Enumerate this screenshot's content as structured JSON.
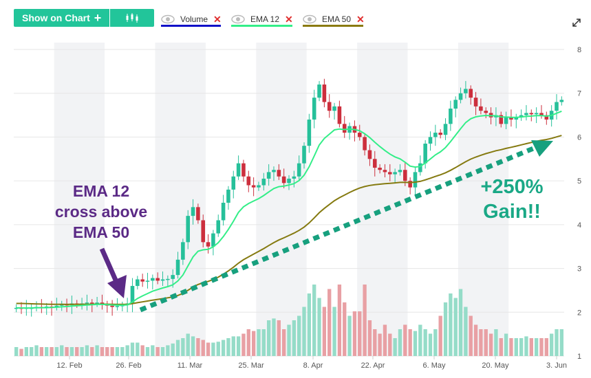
{
  "toolbar": {
    "show_on_chart_label": "Show on Chart",
    "plus_symbol": "+",
    "chart_type_icon": "candlestick-icon"
  },
  "legend": [
    {
      "label": "Volume",
      "color": "#1010c8"
    },
    {
      "label": "EMA 12",
      "color": "#33ee88"
    },
    {
      "label": "EMA 50",
      "color": "#8a7a10"
    }
  ],
  "remove_symbol": "✕",
  "expand_icon": "expand-icon",
  "annotations": {
    "cross_lines": [
      "EMA 12",
      "cross above",
      "EMA 50"
    ],
    "gain_lines": [
      "+250%",
      "Gain!!"
    ]
  },
  "colors": {
    "up": "#26c09a",
    "down": "#cc2f3d",
    "volume_up": "#95dcc8",
    "volume_down": "#e8a0a4",
    "ema12": "#33ee88",
    "ema50": "#857a10",
    "arrow_purple": "#5b2a86",
    "trend_arrow": "#17a07e",
    "band": "#f2f3f5"
  },
  "chart_data": {
    "type": "candlestick",
    "x_tick_labels": [
      "12. Feb",
      "26. Feb",
      "11. Mar",
      "25. Mar",
      "8. Apr",
      "22. Apr",
      "6. May",
      "20. May",
      "3. Jun"
    ],
    "y_tick_labels": [
      "1",
      "2",
      "3",
      "4",
      "5",
      "6",
      "7",
      "8"
    ],
    "ylim": [
      1,
      8
    ],
    "close": [
      2.1,
      2.08,
      2.1,
      2.1,
      2.12,
      2.1,
      2.13,
      2.12,
      2.15,
      2.18,
      2.16,
      2.2,
      2.18,
      2.2,
      2.22,
      2.2,
      2.22,
      2.18,
      2.15,
      2.12,
      2.14,
      2.16,
      2.2,
      2.6,
      2.75,
      2.7,
      2.72,
      2.78,
      2.72,
      2.75,
      2.76,
      2.85,
      3.2,
      3.6,
      4.2,
      4.4,
      4.1,
      3.6,
      3.5,
      3.8,
      4.1,
      4.5,
      4.8,
      5.1,
      5.4,
      5.1,
      4.9,
      4.85,
      4.9,
      5.05,
      5.2,
      5.25,
      5.1,
      4.95,
      5.05,
      5.1,
      5.4,
      5.8,
      6.4,
      6.9,
      7.2,
      6.8,
      6.6,
      6.7,
      6.3,
      6.1,
      6.25,
      6.1,
      6.0,
      5.7,
      5.5,
      5.3,
      5.25,
      5.2,
      5.15,
      5.2,
      5.25,
      5.0,
      4.85,
      5.2,
      5.4,
      5.85,
      6.0,
      6.1,
      6.05,
      6.3,
      6.65,
      6.85,
      7.0,
      7.1,
      6.9,
      6.7,
      6.6,
      6.55,
      6.45,
      6.5,
      6.3,
      6.45,
      6.4,
      6.45,
      6.5,
      6.55,
      6.52,
      6.55,
      6.5,
      6.4,
      6.6,
      6.8,
      6.85
    ],
    "volume": [
      0.1,
      0.08,
      0.1,
      0.1,
      0.12,
      0.1,
      0.1,
      0.1,
      0.1,
      0.12,
      0.1,
      0.1,
      0.1,
      0.1,
      0.12,
      0.1,
      0.12,
      0.1,
      0.1,
      0.1,
      0.1,
      0.1,
      0.12,
      0.15,
      0.15,
      0.12,
      0.1,
      0.12,
      0.1,
      0.1,
      0.12,
      0.14,
      0.18,
      0.2,
      0.25,
      0.22,
      0.2,
      0.18,
      0.15,
      0.15,
      0.16,
      0.18,
      0.2,
      0.22,
      0.22,
      0.25,
      0.3,
      0.28,
      0.3,
      0.3,
      0.4,
      0.42,
      0.4,
      0.3,
      0.35,
      0.4,
      0.45,
      0.55,
      0.7,
      0.8,
      0.65,
      0.55,
      0.75,
      0.55,
      0.8,
      0.6,
      0.45,
      0.5,
      0.5,
      0.8,
      0.4,
      0.3,
      0.25,
      0.35,
      0.25,
      0.2,
      0.3,
      0.35,
      0.3,
      0.28,
      0.35,
      0.3,
      0.25,
      0.3,
      0.45,
      0.6,
      0.7,
      0.65,
      0.75,
      0.55,
      0.45,
      0.35,
      0.3,
      0.3,
      0.25,
      0.3,
      0.2,
      0.25,
      0.2,
      0.2,
      0.2,
      0.22,
      0.2,
      0.2,
      0.2,
      0.2,
      0.25,
      0.3,
      0.3
    ]
  }
}
